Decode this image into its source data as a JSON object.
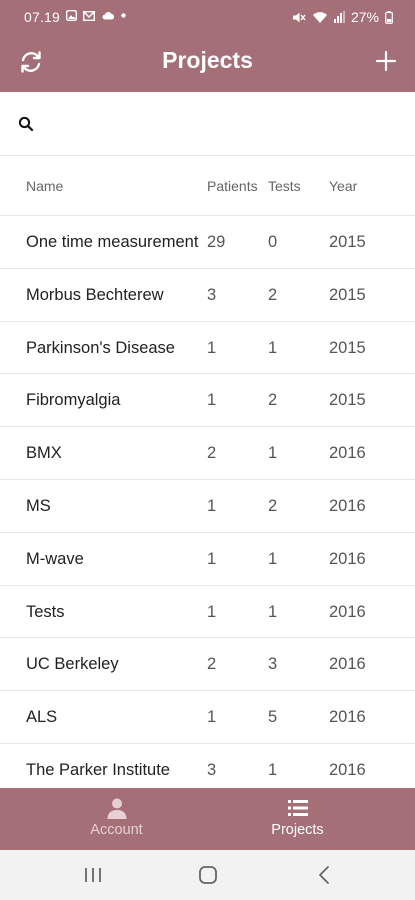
{
  "status_bar": {
    "time": "07.19",
    "left_icons": [
      "image-icon",
      "mail-icon",
      "cloud-icon",
      "dot-icon"
    ],
    "right_icons": [
      "mute-icon",
      "wifi-icon",
      "signal-icon",
      "battery-icon"
    ],
    "battery": "27%"
  },
  "header": {
    "title": "Projects",
    "left_icon": "refresh-icon",
    "right_icon": "plus-icon"
  },
  "search": {
    "icon": "search-icon",
    "placeholder": "",
    "value": ""
  },
  "table": {
    "columns": [
      "Name",
      "Patients",
      "Tests",
      "Year"
    ],
    "rows": [
      {
        "name": "One time measurement",
        "patients": "29",
        "tests": "0",
        "year": "2015"
      },
      {
        "name": "Morbus Bechterew",
        "patients": "3",
        "tests": "2",
        "year": "2015"
      },
      {
        "name": "Parkinson's Disease",
        "patients": "1",
        "tests": "1",
        "year": "2015"
      },
      {
        "name": "Fibromyalgia",
        "patients": "1",
        "tests": "2",
        "year": "2015"
      },
      {
        "name": "BMX",
        "patients": "2",
        "tests": "1",
        "year": "2016"
      },
      {
        "name": "MS",
        "patients": "1",
        "tests": "2",
        "year": "2016"
      },
      {
        "name": "M-wave",
        "patients": "1",
        "tests": "1",
        "year": "2016"
      },
      {
        "name": "Tests",
        "patients": "1",
        "tests": "1",
        "year": "2016"
      },
      {
        "name": "UC Berkeley",
        "patients": "2",
        "tests": "3",
        "year": "2016"
      },
      {
        "name": "ALS",
        "patients": "1",
        "tests": "5",
        "year": "2016"
      },
      {
        "name": "The Parker Institute",
        "patients": "3",
        "tests": "1",
        "year": "2016"
      }
    ]
  },
  "bottom_nav": {
    "items": [
      {
        "label": "Account",
        "icon": "person-icon",
        "active": false
      },
      {
        "label": "Projects",
        "icon": "list-icon",
        "active": true
      }
    ]
  },
  "system_nav": {
    "icons": [
      "recents-icon",
      "home-icon",
      "back-icon"
    ]
  },
  "colors": {
    "accent": "#a56f77",
    "inactive_nav_label": "#e7cfd3",
    "system_nav_bg": "#f2f2f2"
  }
}
